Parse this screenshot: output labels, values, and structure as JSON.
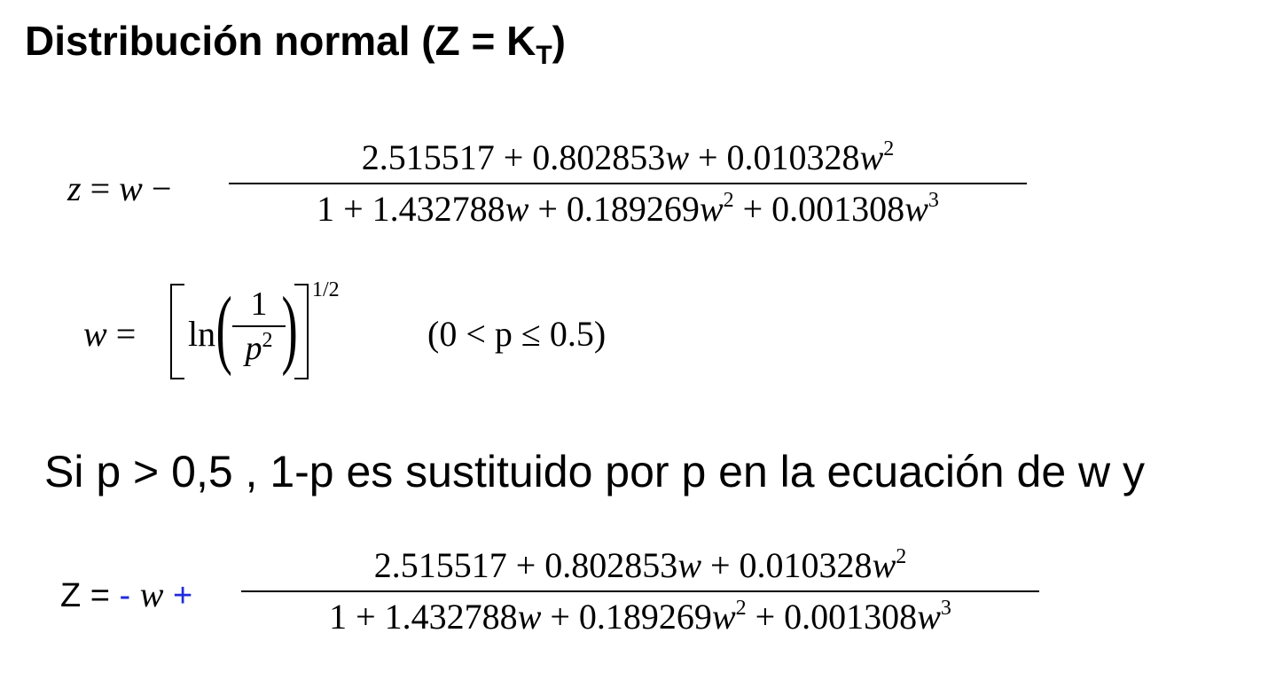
{
  "title": {
    "main": "Distribución normal (Z = K",
    "subscript": "T",
    "close": ")"
  },
  "eq1": {
    "lhs_z": "z",
    "lhs_eq": "=",
    "lhs_w": "w",
    "lhs_minus": "−",
    "numerator_a": "2.515517 + 0.802853",
    "numerator_b": "+ 0.010328",
    "denominator_a": "1 + 1.432788",
    "denominator_b": "+ 0.189269",
    "denominator_c": "+ 0.001308",
    "var": "w",
    "exp2": "2",
    "exp3": "3"
  },
  "eq2": {
    "w": "w",
    "eq": "=",
    "ln": "ln",
    "one": "1",
    "p": "p",
    "p_exp": "2",
    "power": "1/2",
    "condition": "(0 < p ≤ 0.5)"
  },
  "sentence": "Si p > 0,5 , 1-p es sustituido por p en la ecuación de w y",
  "eq3": {
    "lhs": "Z =",
    "minus": "-",
    "w": "w",
    "plus": "+"
  },
  "colors": {
    "accent_blue": "#1f2bdc",
    "text": "#000000",
    "background": "#ffffff"
  }
}
